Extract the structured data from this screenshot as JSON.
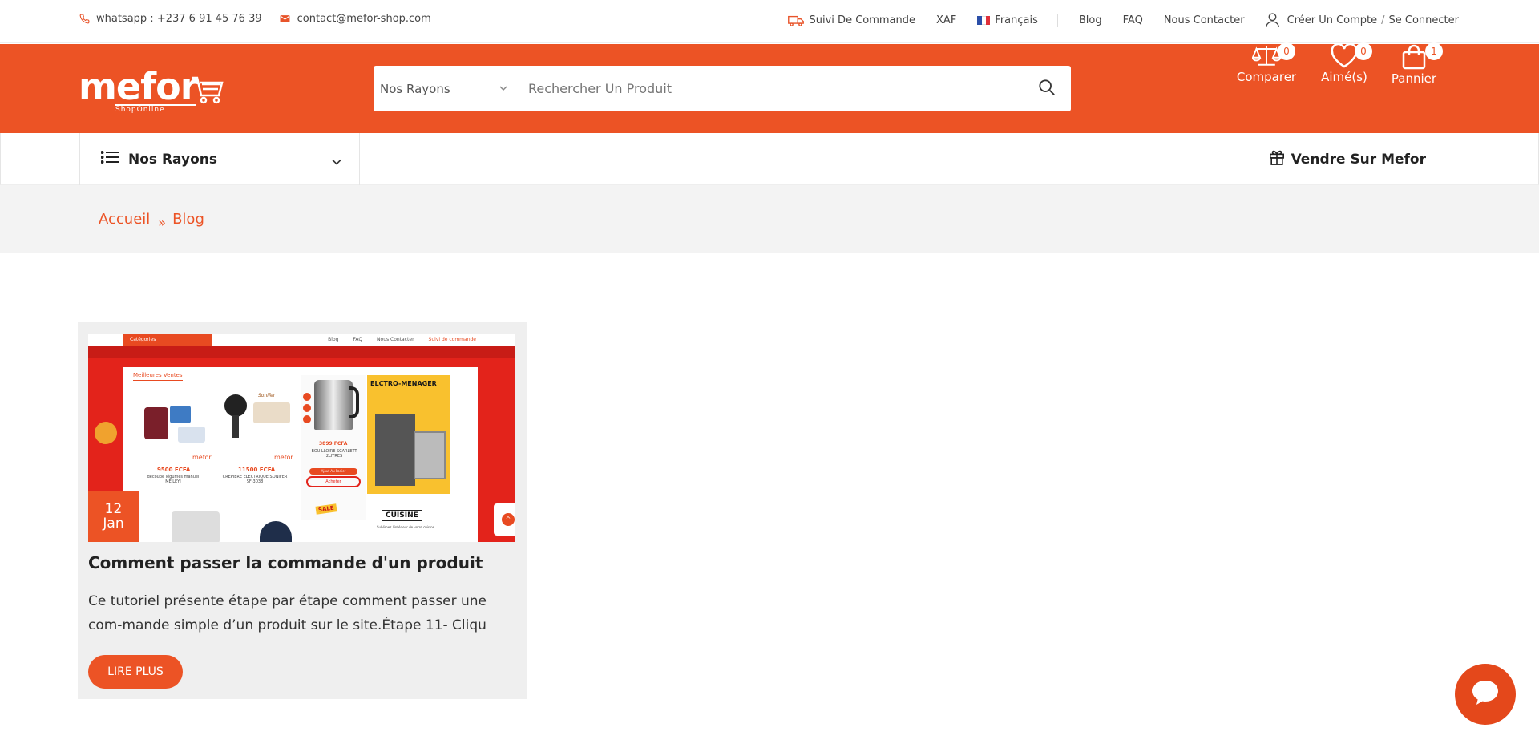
{
  "topbar": {
    "whatsapp": "whatsapp : +237 6 91 45 76 39",
    "email": "contact@mefor-shop.com",
    "tracking": "Suivi De Commande",
    "currency": "XAF",
    "language": "Français",
    "blog": "Blog",
    "faq": "FAQ",
    "contact": "Nous Contacter",
    "register": "Créer Un Compte",
    "divider": "/",
    "login": "Se Connecter"
  },
  "header": {
    "logo_text": "mefor",
    "logo_sub": "ShopOnline",
    "search_category": "Nos Rayons",
    "search_placeholder": "Rechercher Un Produit",
    "compare_label": "Comparer",
    "compare_count": "0",
    "wishlist_label": "Aimé(s)",
    "wishlist_count": "0",
    "cart_label": "Pannier",
    "cart_count": "1"
  },
  "nav": {
    "rayons": "Nos Rayons",
    "sell": "Vendre Sur Mefor"
  },
  "breadcrumb": {
    "home": "Accueil",
    "separator": "»",
    "current": "Blog"
  },
  "post": {
    "day": "12",
    "month": "Jan",
    "title": "Comment passer la commande d'un produit",
    "excerpt": "Ce tutoriel présente étape par étape comment passer une com-mande simple d’un produit sur le site.Étape 11- Cliqu",
    "read_more": "LIRE PLUS",
    "thumb": {
      "category_button": "Catégories",
      "links": [
        "Blog",
        "FAQ",
        "Nous Contacter",
        "Suivi de commande"
      ],
      "section": "Meilleures Ventes",
      "price1": "9500 FCFA",
      "name1": "decoupe légumes manuel MEILEYI",
      "price2": "11500 FCFA",
      "name2": "CREPIERE ELECTRIQUE SONIFER SF-3038",
      "price3": "3899 FCFA",
      "name3": "BOUILLOIRE SCARLETT 2LITRES",
      "add_cart": "Ajout Au Panier",
      "buy": "Acheter",
      "banner": "ELCTRO-MENAGER",
      "cuisine": "CUISINE",
      "cuisine_sub": "Sublimez l'intérieur de votre cuisine",
      "sale": "SALE",
      "brand": "Sonifer"
    }
  },
  "colors": {
    "brand": "#ec5325",
    "breadcrumb_bg": "#f3f3f3",
    "card_bg": "#efefef"
  }
}
